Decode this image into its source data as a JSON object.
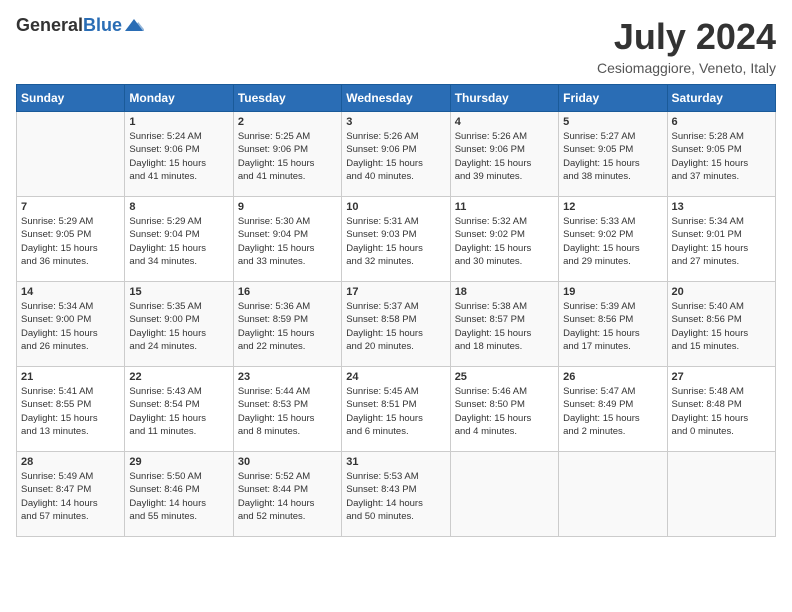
{
  "header": {
    "logo_general": "General",
    "logo_blue": "Blue",
    "month_title": "July 2024",
    "subtitle": "Cesiomaggiore, Veneto, Italy"
  },
  "days_of_week": [
    "Sunday",
    "Monday",
    "Tuesday",
    "Wednesday",
    "Thursday",
    "Friday",
    "Saturday"
  ],
  "weeks": [
    [
      {
        "day": "",
        "info": ""
      },
      {
        "day": "1",
        "info": "Sunrise: 5:24 AM\nSunset: 9:06 PM\nDaylight: 15 hours\nand 41 minutes."
      },
      {
        "day": "2",
        "info": "Sunrise: 5:25 AM\nSunset: 9:06 PM\nDaylight: 15 hours\nand 41 minutes."
      },
      {
        "day": "3",
        "info": "Sunrise: 5:26 AM\nSunset: 9:06 PM\nDaylight: 15 hours\nand 40 minutes."
      },
      {
        "day": "4",
        "info": "Sunrise: 5:26 AM\nSunset: 9:06 PM\nDaylight: 15 hours\nand 39 minutes."
      },
      {
        "day": "5",
        "info": "Sunrise: 5:27 AM\nSunset: 9:05 PM\nDaylight: 15 hours\nand 38 minutes."
      },
      {
        "day": "6",
        "info": "Sunrise: 5:28 AM\nSunset: 9:05 PM\nDaylight: 15 hours\nand 37 minutes."
      }
    ],
    [
      {
        "day": "7",
        "info": "Sunrise: 5:29 AM\nSunset: 9:05 PM\nDaylight: 15 hours\nand 36 minutes."
      },
      {
        "day": "8",
        "info": "Sunrise: 5:29 AM\nSunset: 9:04 PM\nDaylight: 15 hours\nand 34 minutes."
      },
      {
        "day": "9",
        "info": "Sunrise: 5:30 AM\nSunset: 9:04 PM\nDaylight: 15 hours\nand 33 minutes."
      },
      {
        "day": "10",
        "info": "Sunrise: 5:31 AM\nSunset: 9:03 PM\nDaylight: 15 hours\nand 32 minutes."
      },
      {
        "day": "11",
        "info": "Sunrise: 5:32 AM\nSunset: 9:02 PM\nDaylight: 15 hours\nand 30 minutes."
      },
      {
        "day": "12",
        "info": "Sunrise: 5:33 AM\nSunset: 9:02 PM\nDaylight: 15 hours\nand 29 minutes."
      },
      {
        "day": "13",
        "info": "Sunrise: 5:34 AM\nSunset: 9:01 PM\nDaylight: 15 hours\nand 27 minutes."
      }
    ],
    [
      {
        "day": "14",
        "info": "Sunrise: 5:34 AM\nSunset: 9:00 PM\nDaylight: 15 hours\nand 26 minutes."
      },
      {
        "day": "15",
        "info": "Sunrise: 5:35 AM\nSunset: 9:00 PM\nDaylight: 15 hours\nand 24 minutes."
      },
      {
        "day": "16",
        "info": "Sunrise: 5:36 AM\nSunset: 8:59 PM\nDaylight: 15 hours\nand 22 minutes."
      },
      {
        "day": "17",
        "info": "Sunrise: 5:37 AM\nSunset: 8:58 PM\nDaylight: 15 hours\nand 20 minutes."
      },
      {
        "day": "18",
        "info": "Sunrise: 5:38 AM\nSunset: 8:57 PM\nDaylight: 15 hours\nand 18 minutes."
      },
      {
        "day": "19",
        "info": "Sunrise: 5:39 AM\nSunset: 8:56 PM\nDaylight: 15 hours\nand 17 minutes."
      },
      {
        "day": "20",
        "info": "Sunrise: 5:40 AM\nSunset: 8:56 PM\nDaylight: 15 hours\nand 15 minutes."
      }
    ],
    [
      {
        "day": "21",
        "info": "Sunrise: 5:41 AM\nSunset: 8:55 PM\nDaylight: 15 hours\nand 13 minutes."
      },
      {
        "day": "22",
        "info": "Sunrise: 5:43 AM\nSunset: 8:54 PM\nDaylight: 15 hours\nand 11 minutes."
      },
      {
        "day": "23",
        "info": "Sunrise: 5:44 AM\nSunset: 8:53 PM\nDaylight: 15 hours\nand 8 minutes."
      },
      {
        "day": "24",
        "info": "Sunrise: 5:45 AM\nSunset: 8:51 PM\nDaylight: 15 hours\nand 6 minutes."
      },
      {
        "day": "25",
        "info": "Sunrise: 5:46 AM\nSunset: 8:50 PM\nDaylight: 15 hours\nand 4 minutes."
      },
      {
        "day": "26",
        "info": "Sunrise: 5:47 AM\nSunset: 8:49 PM\nDaylight: 15 hours\nand 2 minutes."
      },
      {
        "day": "27",
        "info": "Sunrise: 5:48 AM\nSunset: 8:48 PM\nDaylight: 15 hours\nand 0 minutes."
      }
    ],
    [
      {
        "day": "28",
        "info": "Sunrise: 5:49 AM\nSunset: 8:47 PM\nDaylight: 14 hours\nand 57 minutes."
      },
      {
        "day": "29",
        "info": "Sunrise: 5:50 AM\nSunset: 8:46 PM\nDaylight: 14 hours\nand 55 minutes."
      },
      {
        "day": "30",
        "info": "Sunrise: 5:52 AM\nSunset: 8:44 PM\nDaylight: 14 hours\nand 52 minutes."
      },
      {
        "day": "31",
        "info": "Sunrise: 5:53 AM\nSunset: 8:43 PM\nDaylight: 14 hours\nand 50 minutes."
      },
      {
        "day": "",
        "info": ""
      },
      {
        "day": "",
        "info": ""
      },
      {
        "day": "",
        "info": ""
      }
    ]
  ]
}
